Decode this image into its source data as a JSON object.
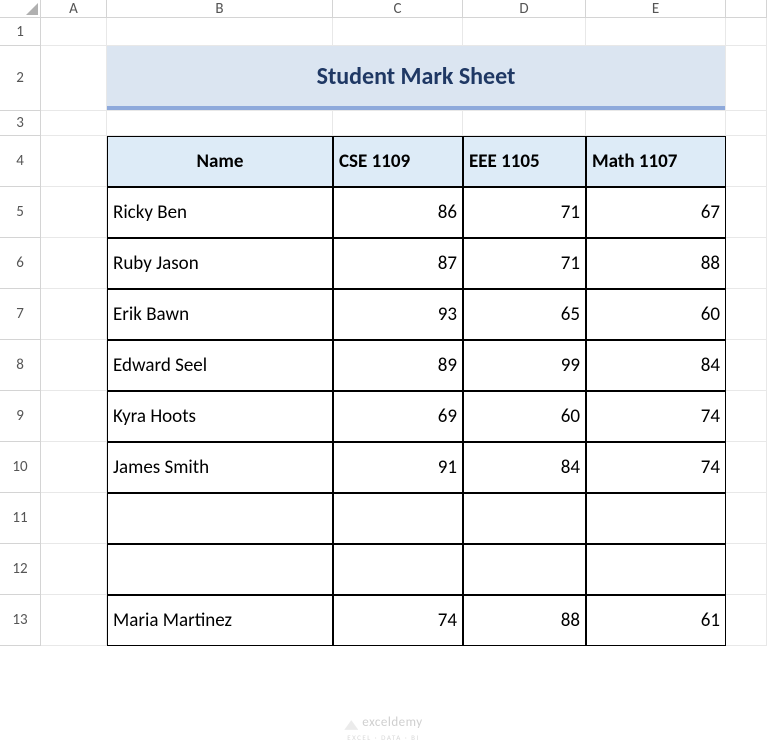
{
  "columns": [
    "A",
    "B",
    "C",
    "D",
    "E",
    ""
  ],
  "rows": [
    "1",
    "2",
    "3",
    "4",
    "5",
    "6",
    "7",
    "8",
    "9",
    "10",
    "11",
    "12",
    "13"
  ],
  "title": "Student Mark Sheet",
  "headers": {
    "name": "Name",
    "cse": "CSE 1109",
    "eee": "EEE 1105",
    "math": "Math 1107"
  },
  "students": [
    {
      "name": "Ricky Ben",
      "cse": "86",
      "eee": "71",
      "math": "67"
    },
    {
      "name": "Ruby Jason",
      "cse": "87",
      "eee": "71",
      "math": "88"
    },
    {
      "name": "Erik Bawn",
      "cse": "93",
      "eee": "65",
      "math": "60"
    },
    {
      "name": "Edward Seel",
      "cse": "89",
      "eee": "99",
      "math": "84"
    },
    {
      "name": "Kyra Hoots",
      "cse": "69",
      "eee": "60",
      "math": "74"
    },
    {
      "name": "James Smith",
      "cse": "91",
      "eee": "84",
      "math": "74"
    },
    {
      "name": "",
      "cse": "",
      "eee": "",
      "math": ""
    },
    {
      "name": "",
      "cse": "",
      "eee": "",
      "math": ""
    },
    {
      "name": "Maria Martinez",
      "cse": "74",
      "eee": "88",
      "math": "61"
    }
  ],
  "watermark": {
    "brand": "exceldemy",
    "tagline": "EXCEL · DATA · BI"
  }
}
